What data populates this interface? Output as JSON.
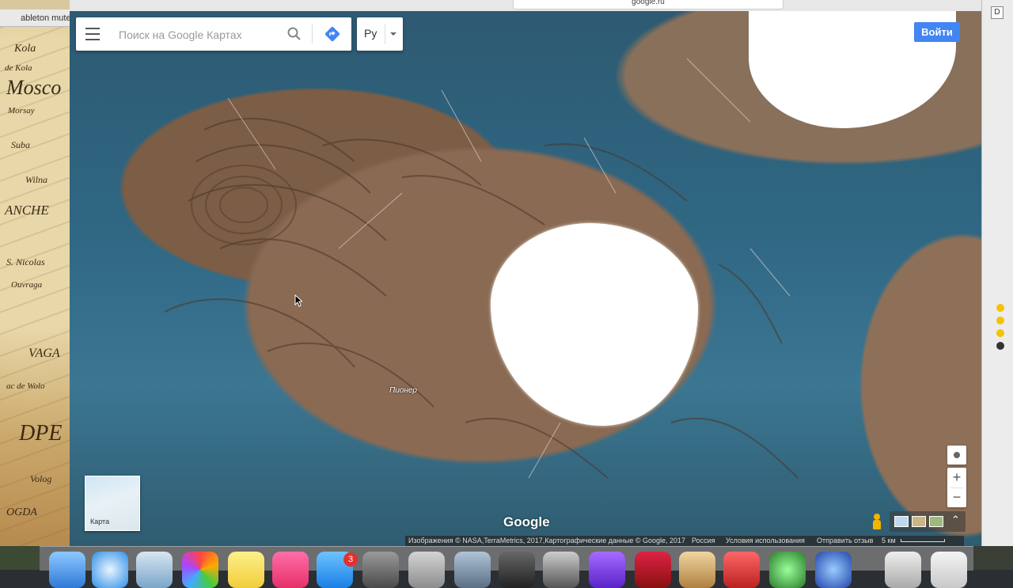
{
  "background_left_app": {
    "tab_label": "ableton mute",
    "map_words": [
      "Kola",
      "de Kola",
      "Mosco",
      "Morsay",
      "Suba",
      "Wilna",
      "ANCHE",
      "S. Nicolas",
      "Ouvraga",
      "VAGA",
      "ac de Wolo",
      "DPE",
      "Volog",
      "OGDA"
    ]
  },
  "browser": {
    "url": "google.ru"
  },
  "search": {
    "placeholder": "Поиск на Google Картах",
    "language_label": "Ру"
  },
  "header": {
    "signin_label": "Войти"
  },
  "map": {
    "place_label": "Пионер",
    "watermark": "Google",
    "minimap_label": "Карта"
  },
  "attribution": {
    "imagery": "Изображения © NASA,TerraMetrics, 2017,Картографические данные © Google, 2017",
    "country": "Россия",
    "terms": "Условия использования",
    "feedback": "Отправить отзыв",
    "scale": "5 км"
  },
  "right_app": {
    "letter": "D"
  },
  "dock": {
    "appstore_badge": "3"
  },
  "colors": {
    "signin_blue": "#4285f4",
    "directions_blue": "#4285f4"
  }
}
